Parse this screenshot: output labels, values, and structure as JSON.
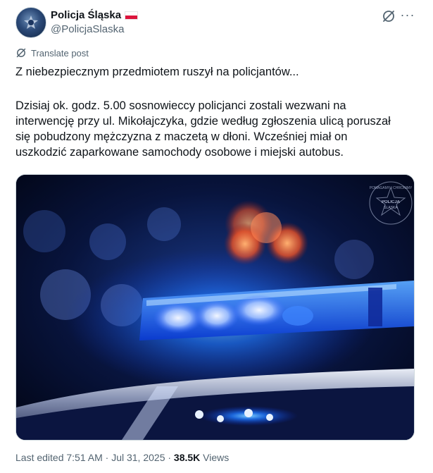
{
  "author": {
    "display_name": "Policja Śląska",
    "handle": "@PolicjaSlaska",
    "flag_colors": [
      "#ffffff",
      "#dc143c"
    ]
  },
  "header_actions": {
    "grok_icon": "grok-icon",
    "more_label": "···"
  },
  "translate": {
    "label": "Translate post",
    "icon": "translate-icon"
  },
  "post": {
    "title_line": "Z niebezpiecznym przedmiotem ruszył na policjantów...",
    "body_lines": [
      "Dzisiaj ok. godz. 5.00 sosnowieccy policjanci zostali wezwani na",
      "interwencję przy ul. Mikołajczyka, gdzie według zgłoszenia ulicą poruszał",
      "się pobudzony mężczyzna z maczetą w dłoni. Wcześniej miał on",
      "uszkodzić zaparkowane samochody osobowe i miejski autobus."
    ]
  },
  "media": {
    "description_icon": "police-lightbar-photo",
    "watermark": {
      "top_text": "POMAGAMY I CHRONIMY",
      "badge_text": "POLICJA",
      "sub_text": "ŚLĄSKA"
    }
  },
  "footer": {
    "edited": "Last edited 7:51 AM · Jul 31, 2025 · ",
    "views_count": "38.5K",
    "views_label": " Views"
  },
  "colors": {
    "accent_red": "#dc143c",
    "muted": "#536471",
    "text": "#0f1419",
    "border": "#cfd9de"
  }
}
